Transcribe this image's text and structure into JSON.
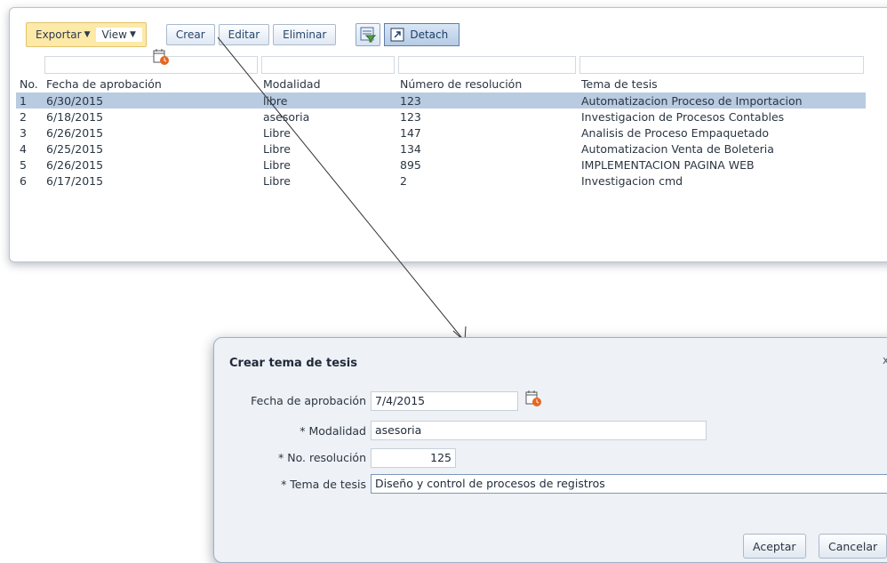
{
  "toolbar": {
    "export_label": "Exportar",
    "view_label": "View",
    "create_label": "Crear",
    "edit_label": "Editar",
    "delete_label": "Eliminar",
    "detach_label": "Detach"
  },
  "table": {
    "columns": [
      "No.",
      "Fecha de aprobación",
      "Modalidad",
      "Número de resolución",
      "Tema de tesis"
    ],
    "rows": [
      [
        "1",
        "6/30/2015",
        "libre",
        "123",
        "Automatizacion Proceso de Importacion"
      ],
      [
        "2",
        "6/18/2015",
        "asesoria",
        "123",
        "Investigacion de Procesos Contables"
      ],
      [
        "3",
        "6/26/2015",
        "Libre",
        "147",
        "Analisis de Proceso Empaquetado"
      ],
      [
        "4",
        "6/25/2015",
        "Libre",
        "134",
        "Automatizacion Venta de Boleteria"
      ],
      [
        "5",
        "6/26/2015",
        "Libre",
        "895",
        "IMPLEMENTACION PAGINA WEB"
      ],
      [
        "6",
        "6/17/2015",
        "Libre",
        "2",
        "Investigacion cmd"
      ]
    ],
    "selected_row": 1
  },
  "dialog": {
    "title": "Crear tema de tesis",
    "close": "x",
    "fields": {
      "fecha_label": "Fecha de aprobación",
      "fecha_value": "7/4/2015",
      "modalidad_label": "* Modalidad",
      "modalidad_value": "asesoria",
      "resolucion_label": "* No. resolución",
      "resolucion_value": "125",
      "tema_label": "* Tema de tesis",
      "tema_value": "Diseño y control de procesos de registros"
    },
    "accept_label": "Aceptar",
    "cancel_label": "Cancelar"
  },
  "icons": {
    "calendar": "calendar-icon",
    "filter": "filter-icon",
    "detach": "detach-icon"
  },
  "colors": {
    "selected_row": "#b8cbe1",
    "menu_highlight": "#fde9a8"
  }
}
